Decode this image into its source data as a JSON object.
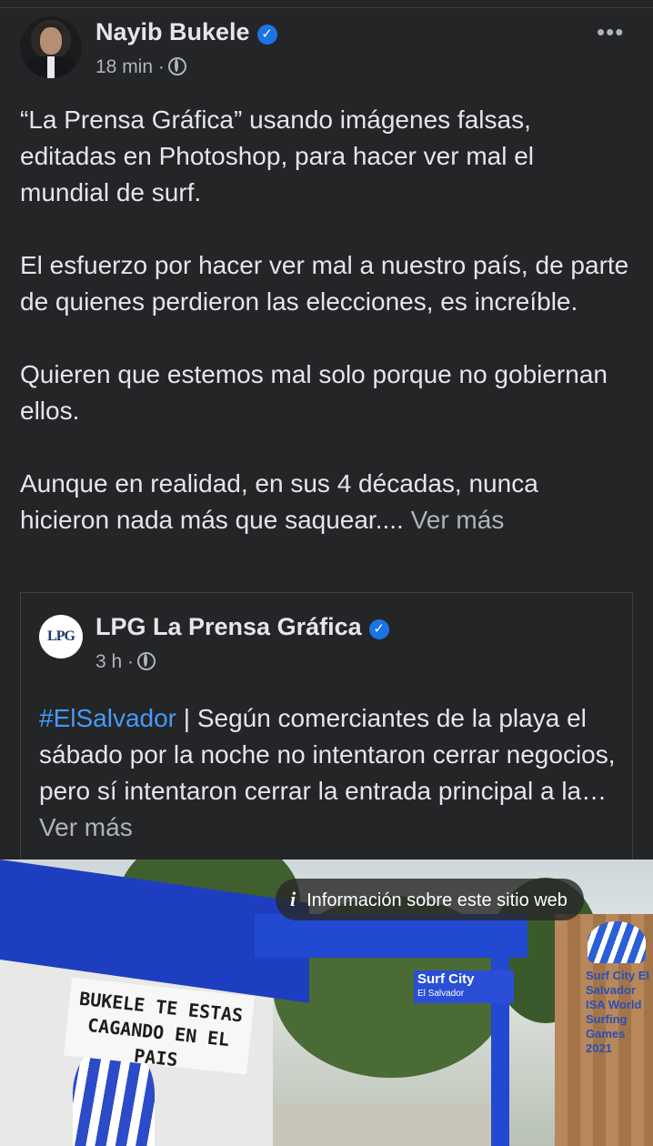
{
  "post": {
    "author": "Nayib Bukele",
    "time": "18 min",
    "dot": "·",
    "paragraphs": [
      "“La Prensa Gráfica” usando imágenes falsas, editadas en Photoshop, para hacer ver mal el mundial de surf.",
      "El esfuerzo por hacer ver mal a nuestro país, de parte de quienes perdieron las elecciones, es increíble.",
      "Quieren que estemos mal solo porque no gobiernan ellos."
    ],
    "last_paragraph": "Aunque en realidad, en sus 4 décadas, nunca hicieron nada más que saquear....",
    "see_more": "Ver más",
    "more_icon": "more-horizontal-icon",
    "verified_icon": "verified-badge-icon",
    "privacy_icon": "globe-icon"
  },
  "shared": {
    "logo_text": "LPG",
    "author": "LPG La Prensa Gráfica",
    "time": "3 h",
    "dot": "·",
    "hashtag": "#ElSalvador",
    "text": " | Según comerciantes de la playa el sábado por la noche no intentaron cerrar negocios, pero sí intentaron cerrar la entrada principal a la…",
    "see_more": "Ver más"
  },
  "photo": {
    "banner_line1": "BUKELE TE ESTAS",
    "banner_line2": "CAGANDO EN EL PAIS",
    "gate_sign": "Surf City",
    "gate_sign_sub": "El Salvador",
    "wall_sign": "Surf City El Salvador ISA World Surfing Games 2021",
    "info_chip": "Información sobre este sitio web",
    "info_icon": "info-icon"
  },
  "colors": {
    "background": "#242526",
    "text": "#e4e6eb",
    "secondary": "#b0b3b8",
    "link": "#4599ff",
    "verified": "#1b74e4"
  }
}
